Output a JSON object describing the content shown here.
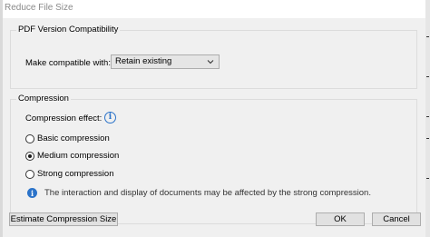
{
  "window": {
    "title": "Reduce File Size"
  },
  "pdf_version": {
    "group_title": "PDF Version Compatibility",
    "make_compatible_label": "Make compatible with:",
    "selected_value": "Retain existing"
  },
  "compression": {
    "group_title": "Compression",
    "effect_label": "Compression effect:",
    "info_icon_glyph": "i",
    "options": [
      {
        "label": "Basic compression",
        "selected": false
      },
      {
        "label": "Medium compression",
        "selected": true
      },
      {
        "label": "Strong compression",
        "selected": false
      }
    ],
    "note": "The interaction and display of documents may be affected by the strong compression."
  },
  "buttons": {
    "estimate": "Estimate Compression Size",
    "ok": "OK",
    "cancel": "Cancel"
  },
  "colors": {
    "dialog_background": "#f0f0f0",
    "button_background": "#e1e1e1",
    "info_blue": "#2b73c9",
    "title_gray": "#8a8a8a"
  },
  "icons": {
    "dropdown": "chevron-down-icon",
    "info": "info-icon"
  }
}
